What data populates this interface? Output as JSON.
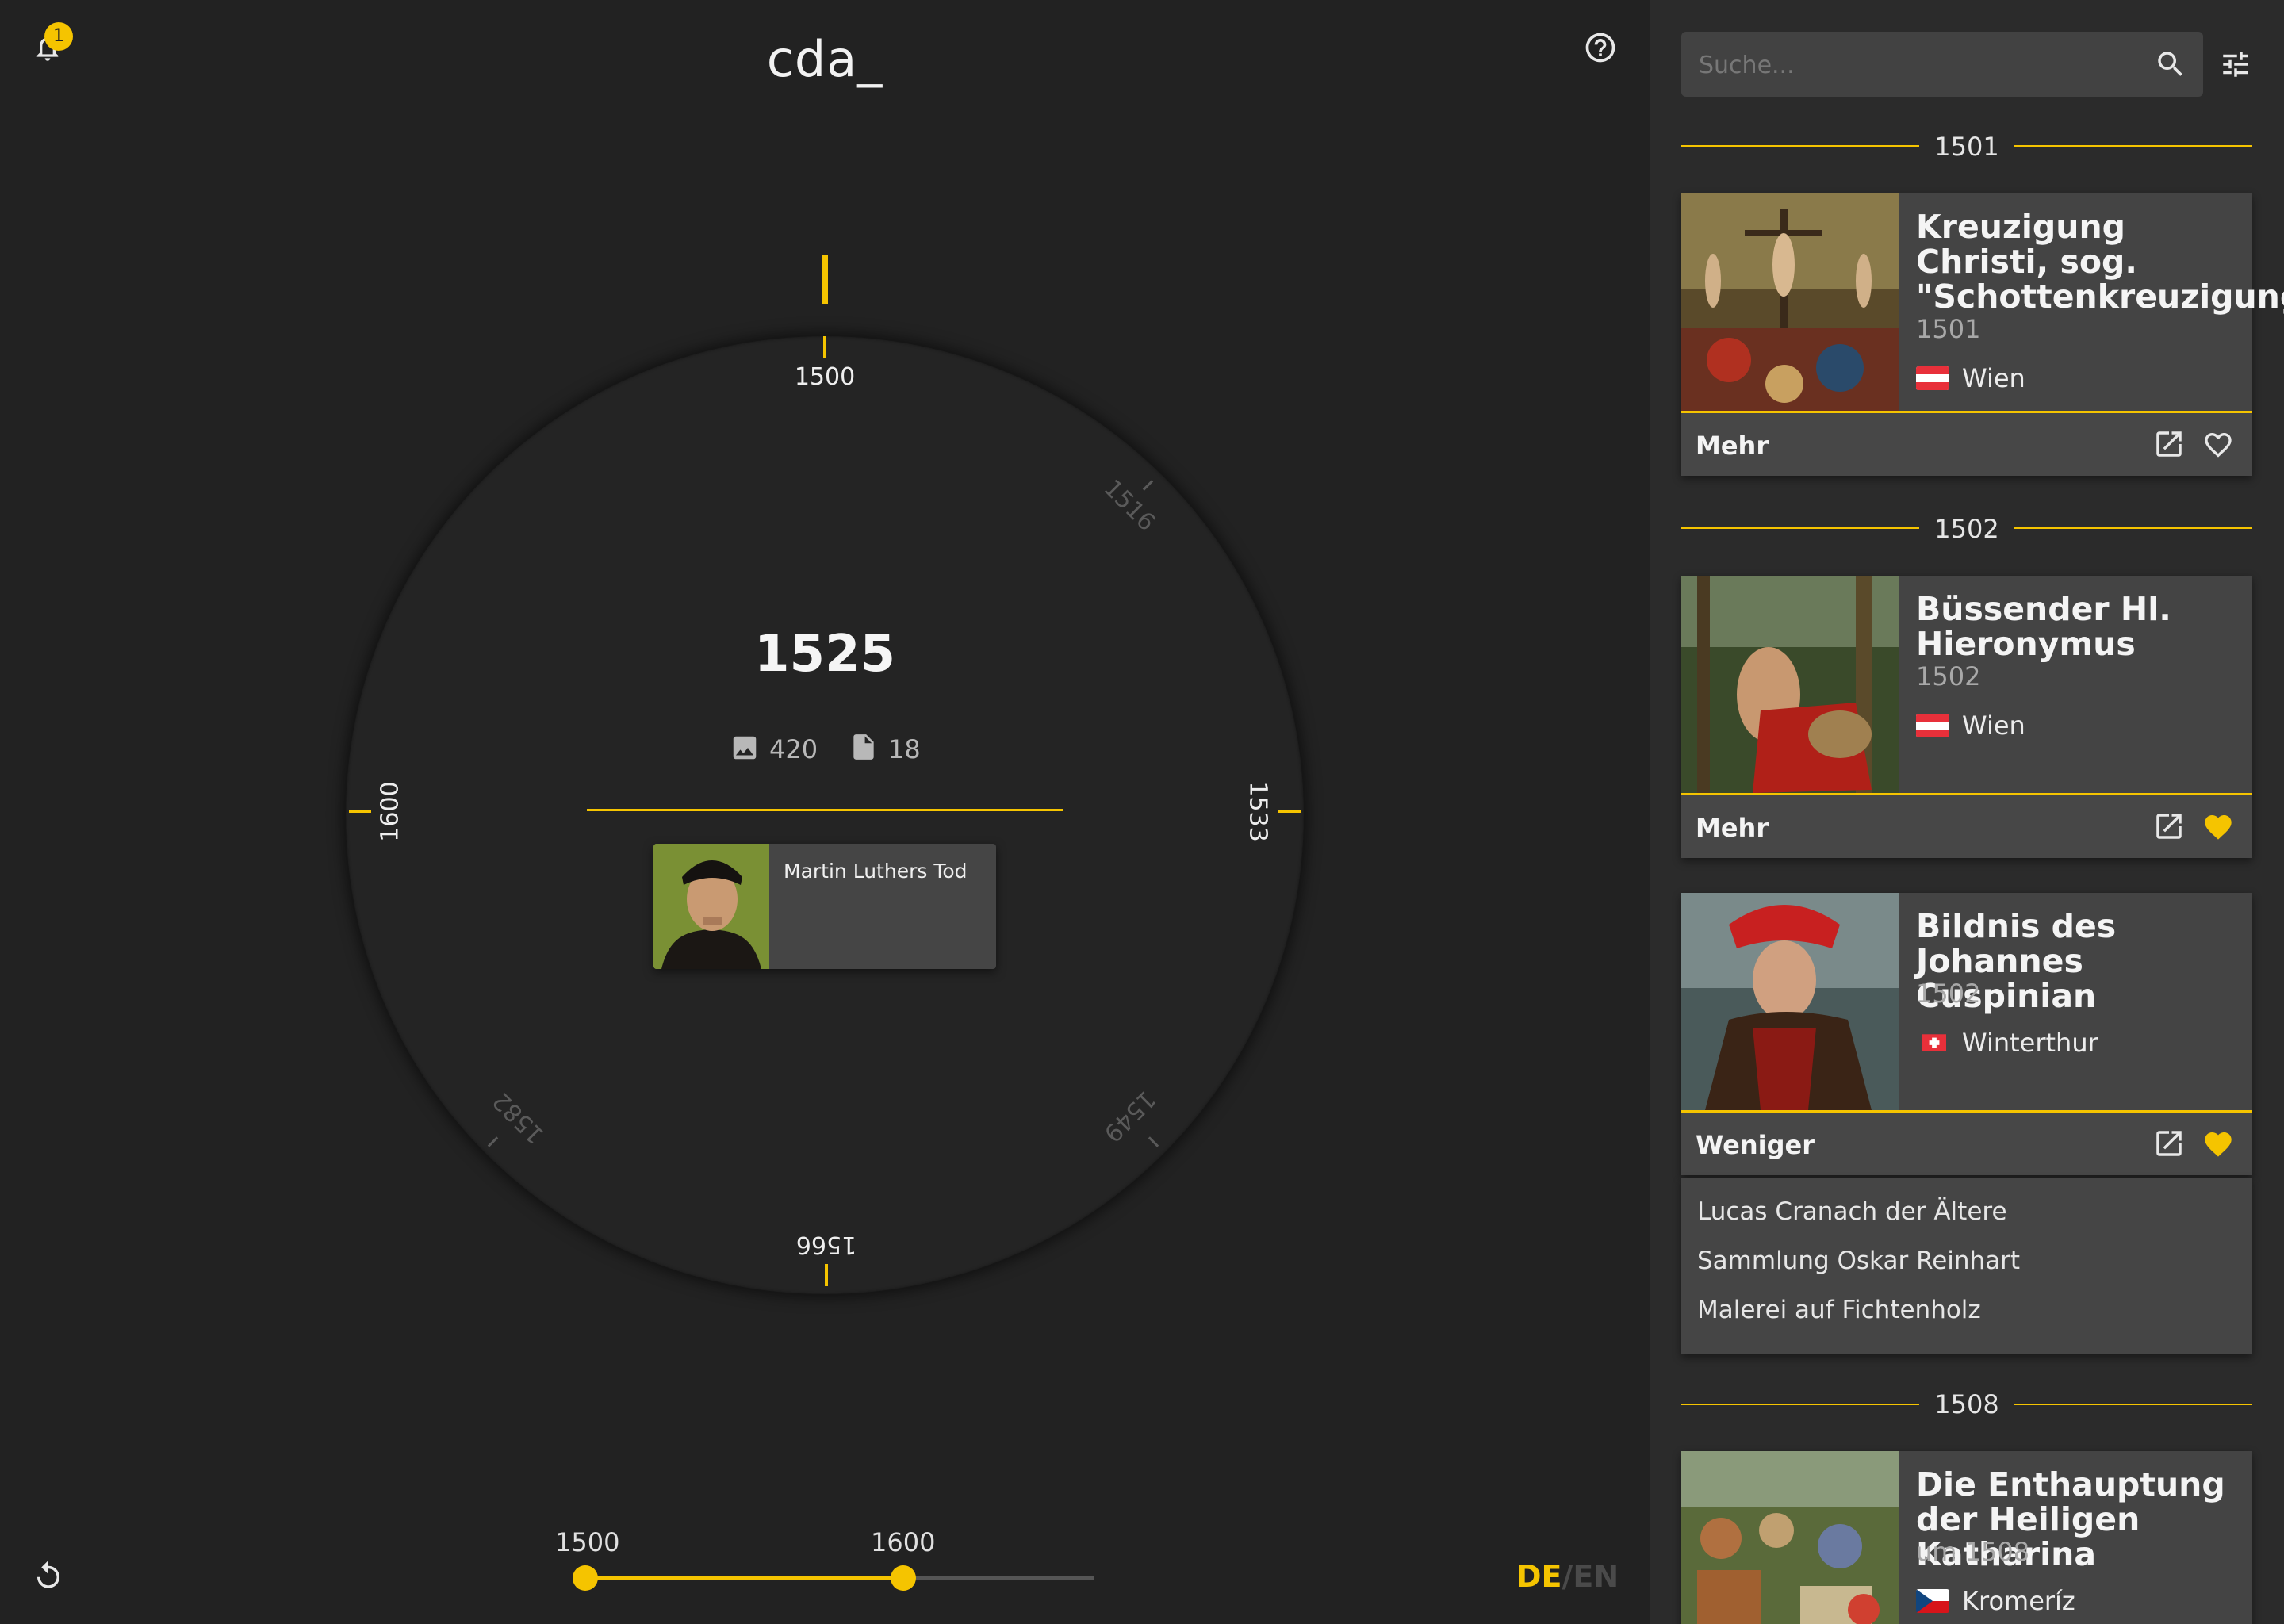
{
  "app": {
    "title": "cda_",
    "notification_count": "1"
  },
  "timeline": {
    "center_year": "1525",
    "stats": {
      "images": "420",
      "documents": "18"
    },
    "ring_labels": {
      "top": "1500",
      "right": "1533",
      "left": "1600",
      "bottom": "1566",
      "top_right": "1516",
      "bottom_right": "1549",
      "bottom_left": "1582"
    },
    "event_card": {
      "title": "Martin Luthers Tod"
    }
  },
  "range_slider": {
    "min_label": "1500",
    "max_label": "1600",
    "min": 1500,
    "max": 1600,
    "from": 1500,
    "to": 1600,
    "scale_max": 1660
  },
  "language": {
    "active": "DE",
    "separator": "/",
    "inactive": "EN"
  },
  "colors": {
    "accent": "#f5c400",
    "background": "#222222",
    "panel": "#2b2b2b",
    "card": "#444444"
  },
  "search": {
    "placeholder": "Suche..."
  },
  "results": [
    {
      "year_header": "1501",
      "title": "Kreuzigung Christi, sog. \"Schottenkreuzigung\"",
      "date": "1501",
      "location": "Wien",
      "flag": "AT",
      "toggle_label": "Mehr",
      "favorite": false
    },
    {
      "year_header": "1502",
      "title": "Büssender Hl. Hieronymus",
      "date": "1502",
      "location": "Wien",
      "flag": "AT",
      "toggle_label": "Mehr",
      "favorite": true
    },
    {
      "title": "Bildnis des Johannes Cuspinian",
      "date": "1502",
      "location": "Winterthur",
      "flag": "CH",
      "toggle_label": "Weniger",
      "favorite": true,
      "details": [
        "Lucas Cranach der Ältere",
        "Sammlung Oskar Reinhart",
        "Malerei auf Fichtenholz"
      ]
    },
    {
      "year_header": "1508",
      "title": "Die Enthauptung der Heiligen Katharina",
      "date": "um 1508",
      "location": "Kromeríz",
      "flag": "CZ"
    }
  ]
}
